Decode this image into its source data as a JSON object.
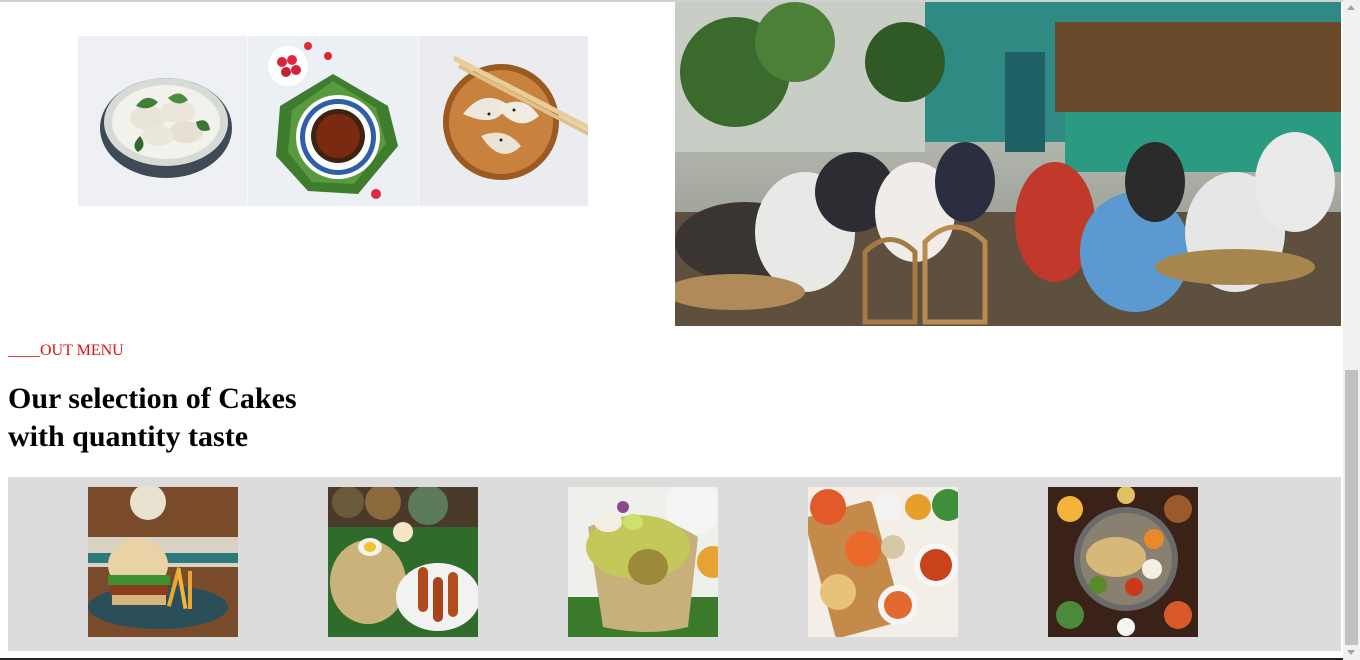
{
  "intro": {
    "images": [
      {
        "name": "dumplings-bowl-image"
      },
      {
        "name": "tea-cup-image"
      },
      {
        "name": "dumplings-plate-image"
      }
    ],
    "restaurant_image": "restaurant-interior-image"
  },
  "menu": {
    "eyebrow": "____OUT MENU",
    "heading_line1": "Our selection of Cakes",
    "heading_line2": "with quantity taste"
  },
  "gallery": {
    "items": [
      {
        "name": "burger-image"
      },
      {
        "name": "biryani-plate-image"
      },
      {
        "name": "biryani-wrap-image"
      },
      {
        "name": "dishes-spread-image"
      },
      {
        "name": "thali-platter-image"
      }
    ]
  },
  "colors": {
    "accent": "#e01010",
    "gallery_bg": "#dcdcdc"
  }
}
